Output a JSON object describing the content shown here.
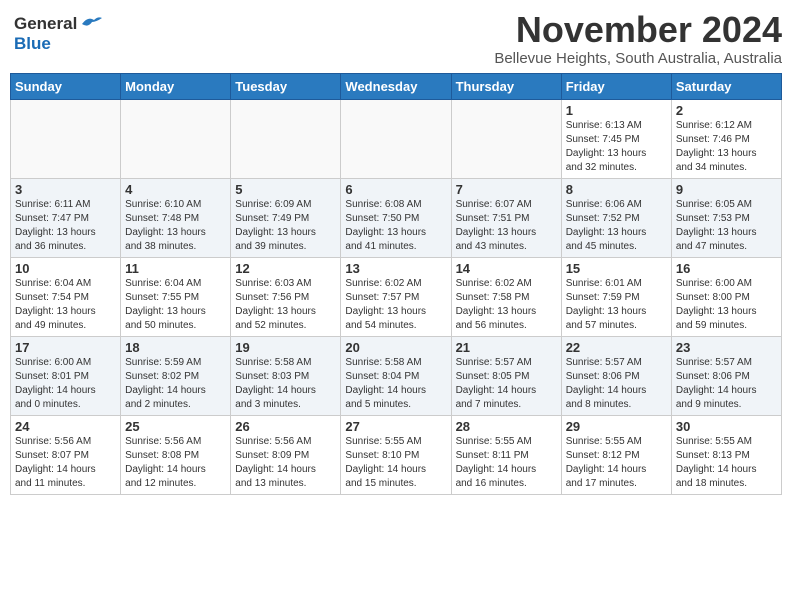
{
  "header": {
    "logo_general": "General",
    "logo_blue": "Blue",
    "month_title": "November 2024",
    "subtitle": "Bellevue Heights, South Australia, Australia"
  },
  "calendar": {
    "weekdays": [
      "Sunday",
      "Monday",
      "Tuesday",
      "Wednesday",
      "Thursday",
      "Friday",
      "Saturday"
    ],
    "weeks": [
      [
        {
          "day": "",
          "info": ""
        },
        {
          "day": "",
          "info": ""
        },
        {
          "day": "",
          "info": ""
        },
        {
          "day": "",
          "info": ""
        },
        {
          "day": "",
          "info": ""
        },
        {
          "day": "1",
          "info": "Sunrise: 6:13 AM\nSunset: 7:45 PM\nDaylight: 13 hours\nand 32 minutes."
        },
        {
          "day": "2",
          "info": "Sunrise: 6:12 AM\nSunset: 7:46 PM\nDaylight: 13 hours\nand 34 minutes."
        }
      ],
      [
        {
          "day": "3",
          "info": "Sunrise: 6:11 AM\nSunset: 7:47 PM\nDaylight: 13 hours\nand 36 minutes."
        },
        {
          "day": "4",
          "info": "Sunrise: 6:10 AM\nSunset: 7:48 PM\nDaylight: 13 hours\nand 38 minutes."
        },
        {
          "day": "5",
          "info": "Sunrise: 6:09 AM\nSunset: 7:49 PM\nDaylight: 13 hours\nand 39 minutes."
        },
        {
          "day": "6",
          "info": "Sunrise: 6:08 AM\nSunset: 7:50 PM\nDaylight: 13 hours\nand 41 minutes."
        },
        {
          "day": "7",
          "info": "Sunrise: 6:07 AM\nSunset: 7:51 PM\nDaylight: 13 hours\nand 43 minutes."
        },
        {
          "day": "8",
          "info": "Sunrise: 6:06 AM\nSunset: 7:52 PM\nDaylight: 13 hours\nand 45 minutes."
        },
        {
          "day": "9",
          "info": "Sunrise: 6:05 AM\nSunset: 7:53 PM\nDaylight: 13 hours\nand 47 minutes."
        }
      ],
      [
        {
          "day": "10",
          "info": "Sunrise: 6:04 AM\nSunset: 7:54 PM\nDaylight: 13 hours\nand 49 minutes."
        },
        {
          "day": "11",
          "info": "Sunrise: 6:04 AM\nSunset: 7:55 PM\nDaylight: 13 hours\nand 50 minutes."
        },
        {
          "day": "12",
          "info": "Sunrise: 6:03 AM\nSunset: 7:56 PM\nDaylight: 13 hours\nand 52 minutes."
        },
        {
          "day": "13",
          "info": "Sunrise: 6:02 AM\nSunset: 7:57 PM\nDaylight: 13 hours\nand 54 minutes."
        },
        {
          "day": "14",
          "info": "Sunrise: 6:02 AM\nSunset: 7:58 PM\nDaylight: 13 hours\nand 56 minutes."
        },
        {
          "day": "15",
          "info": "Sunrise: 6:01 AM\nSunset: 7:59 PM\nDaylight: 13 hours\nand 57 minutes."
        },
        {
          "day": "16",
          "info": "Sunrise: 6:00 AM\nSunset: 8:00 PM\nDaylight: 13 hours\nand 59 minutes."
        }
      ],
      [
        {
          "day": "17",
          "info": "Sunrise: 6:00 AM\nSunset: 8:01 PM\nDaylight: 14 hours\nand 0 minutes."
        },
        {
          "day": "18",
          "info": "Sunrise: 5:59 AM\nSunset: 8:02 PM\nDaylight: 14 hours\nand 2 minutes."
        },
        {
          "day": "19",
          "info": "Sunrise: 5:58 AM\nSunset: 8:03 PM\nDaylight: 14 hours\nand 3 minutes."
        },
        {
          "day": "20",
          "info": "Sunrise: 5:58 AM\nSunset: 8:04 PM\nDaylight: 14 hours\nand 5 minutes."
        },
        {
          "day": "21",
          "info": "Sunrise: 5:57 AM\nSunset: 8:05 PM\nDaylight: 14 hours\nand 7 minutes."
        },
        {
          "day": "22",
          "info": "Sunrise: 5:57 AM\nSunset: 8:06 PM\nDaylight: 14 hours\nand 8 minutes."
        },
        {
          "day": "23",
          "info": "Sunrise: 5:57 AM\nSunset: 8:06 PM\nDaylight: 14 hours\nand 9 minutes."
        }
      ],
      [
        {
          "day": "24",
          "info": "Sunrise: 5:56 AM\nSunset: 8:07 PM\nDaylight: 14 hours\nand 11 minutes."
        },
        {
          "day": "25",
          "info": "Sunrise: 5:56 AM\nSunset: 8:08 PM\nDaylight: 14 hours\nand 12 minutes."
        },
        {
          "day": "26",
          "info": "Sunrise: 5:56 AM\nSunset: 8:09 PM\nDaylight: 14 hours\nand 13 minutes."
        },
        {
          "day": "27",
          "info": "Sunrise: 5:55 AM\nSunset: 8:10 PM\nDaylight: 14 hours\nand 15 minutes."
        },
        {
          "day": "28",
          "info": "Sunrise: 5:55 AM\nSunset: 8:11 PM\nDaylight: 14 hours\nand 16 minutes."
        },
        {
          "day": "29",
          "info": "Sunrise: 5:55 AM\nSunset: 8:12 PM\nDaylight: 14 hours\nand 17 minutes."
        },
        {
          "day": "30",
          "info": "Sunrise: 5:55 AM\nSunset: 8:13 PM\nDaylight: 14 hours\nand 18 minutes."
        }
      ]
    ]
  }
}
